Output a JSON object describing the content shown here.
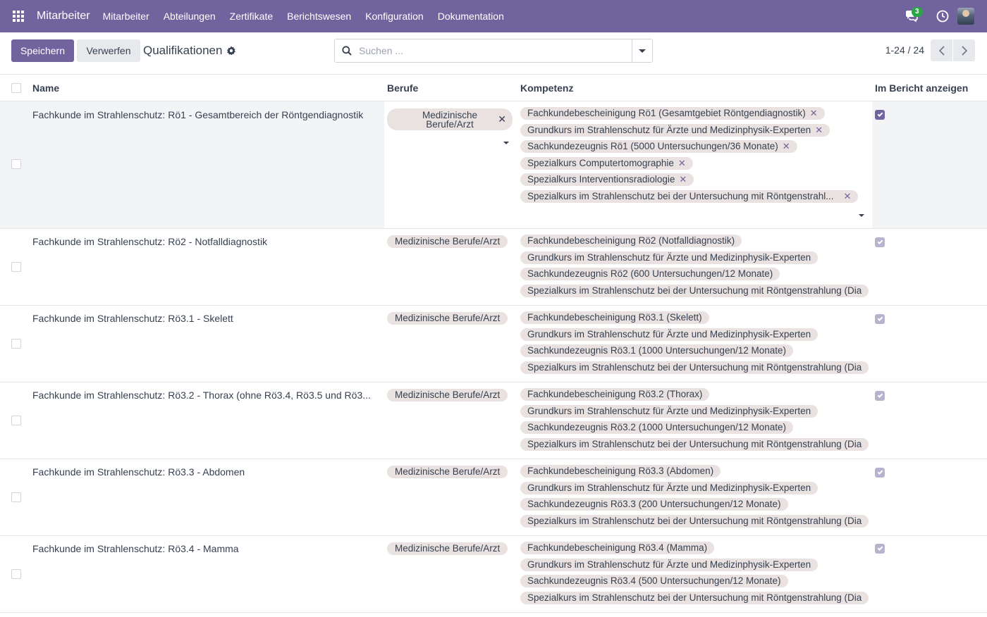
{
  "navbar": {
    "app_name": "Mitarbeiter",
    "menu": [
      "Mitarbeiter",
      "Abteilungen",
      "Zertifikate",
      "Berichtswesen",
      "Konfiguration",
      "Dokumentation"
    ],
    "message_count": "3",
    "accent_color": "#71639e"
  },
  "control": {
    "save_label": "Speichern",
    "discard_label": "Verwerfen",
    "title": "Qualifikationen",
    "search_placeholder": "Suchen ...",
    "pager": "1-24 / 24"
  },
  "table": {
    "columns": [
      "Name",
      "Berufe",
      "Kompetenz",
      "Im Bericht anzeigen"
    ],
    "edit_row": {
      "name": "Fachkunde im Strahlenschutz: Rö1 - Gesamtbereich der Röntgendiagnostik",
      "beruf": "Medizinische Berufe/Arzt",
      "kompetenzen": [
        "Fachkundebescheinigung Rö1 (Gesamtgebiet Röntgendiagnostik)",
        "Grundkurs im Strahlenschutz für Ärzte und Medizinphysik-Experten",
        "Sachkundezeugnis Rö1 (5000 Untersuchungen/36 Monate)",
        "Spezialkurs Computertomographie",
        "Spezialkurs Interventionsradiologie",
        "Spezialkurs im Strahlenschutz bei der Untersuchung mit Röntgenstrahl..."
      ],
      "im_bericht": true
    },
    "rows": [
      {
        "name": "Fachkunde im Strahlenschutz: Rö2 - Notfalldiagnostik",
        "beruf": "Medizinische Berufe/Arzt",
        "kompetenzen": [
          "Fachkundebescheinigung Rö2 (Notfalldiagnostik)",
          "Grundkurs im Strahlenschutz für Ärzte und Medizinphysik-Experten",
          "Sachkundezeugnis Rö2 (600 Untersuchungen/12 Monate)",
          "Spezialkurs im Strahlenschutz bei der Untersuchung mit Röntgenstrahlung (Dia"
        ],
        "im_bericht": true
      },
      {
        "name": "Fachkunde im Strahlenschutz: Rö3.1 - Skelett",
        "beruf": "Medizinische Berufe/Arzt",
        "kompetenzen": [
          "Fachkundebescheinigung Rö3.1 (Skelett)",
          "Grundkurs im Strahlenschutz für Ärzte und Medizinphysik-Experten",
          "Sachkundezeugnis Rö3.1 (1000 Untersuchungen/12 Monate)",
          "Spezialkurs im Strahlenschutz bei der Untersuchung mit Röntgenstrahlung (Dia"
        ],
        "im_bericht": true
      },
      {
        "name": "Fachkunde im Strahlenschutz: Rö3.2 - Thorax (ohne Rö3.4, Rö3.5 und Rö3...",
        "beruf": "Medizinische Berufe/Arzt",
        "kompetenzen": [
          "Fachkundebescheinigung Rö3.2 (Thorax)",
          "Grundkurs im Strahlenschutz für Ärzte und Medizinphysik-Experten",
          "Sachkundezeugnis Rö3.2 (1000 Untersuchungen/12 Monate)",
          "Spezialkurs im Strahlenschutz bei der Untersuchung mit Röntgenstrahlung (Dia"
        ],
        "im_bericht": true
      },
      {
        "name": "Fachkunde im Strahlenschutz: Rö3.3 - Abdomen",
        "beruf": "Medizinische Berufe/Arzt",
        "kompetenzen": [
          "Fachkundebescheinigung Rö3.3 (Abdomen)",
          "Grundkurs im Strahlenschutz für Ärzte und Medizinphysik-Experten",
          "Sachkundezeugnis Rö3.3 (200 Untersuchungen/12 Monate)",
          "Spezialkurs im Strahlenschutz bei der Untersuchung mit Röntgenstrahlung (Dia"
        ],
        "im_bericht": true
      },
      {
        "name": "Fachkunde im Strahlenschutz: Rö3.4 - Mamma",
        "beruf": "Medizinische Berufe/Arzt",
        "kompetenzen": [
          "Fachkundebescheinigung Rö3.4 (Mamma)",
          "Grundkurs im Strahlenschutz für Ärzte und Medizinphysik-Experten",
          "Sachkundezeugnis Rö3.4 (500 Untersuchungen/12 Monate)",
          "Spezialkurs im Strahlenschutz bei der Untersuchung mit Röntgenstrahlung (Dia"
        ],
        "im_bericht": true
      }
    ]
  }
}
